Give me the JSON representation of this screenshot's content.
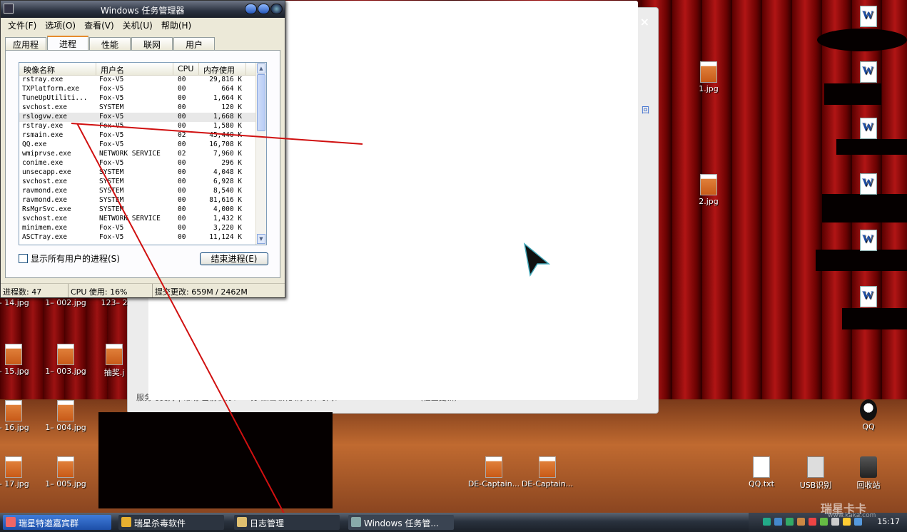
{
  "task_manager": {
    "title": "Windows 任务管理器",
    "menu": [
      "文件(F)",
      "选项(O)",
      "查看(V)",
      "关机(U)",
      "帮助(H)"
    ],
    "tabs": [
      "应用程序",
      "进程",
      "性能",
      "联网",
      "用户"
    ],
    "active_tab": "进程",
    "columns": [
      "映像名称",
      "用户名",
      "CPU",
      "内存使用"
    ],
    "rows": [
      [
        "rstray.exe",
        "Fox-V5",
        "00",
        "29,816 K"
      ],
      [
        "TXPlatform.exe",
        "Fox-V5",
        "00",
        "664 K"
      ],
      [
        "TuneUpUtiliti...",
        "Fox-V5",
        "00",
        "1,664 K"
      ],
      [
        "svchost.exe",
        "SYSTEM",
        "00",
        "120 K"
      ],
      [
        "rslogvw.exe",
        "Fox-V5",
        "00",
        "1,668 K"
      ],
      [
        "rstray.exe",
        "Fox-V5",
        "00",
        "1,580 K"
      ],
      [
        "rsmain.exe",
        "Fox-V5",
        "02",
        "45,440 K"
      ],
      [
        "QQ.exe",
        "Fox-V5",
        "00",
        "16,708 K"
      ],
      [
        "wmiprvse.exe",
        "NETWORK SERVICE",
        "02",
        "7,960 K"
      ],
      [
        "conime.exe",
        "Fox-V5",
        "00",
        "296 K"
      ],
      [
        "unsecapp.exe",
        "SYSTEM",
        "00",
        "4,048 K"
      ],
      [
        "svchost.exe",
        "SYSTEM",
        "00",
        "6,928 K"
      ],
      [
        "ravmond.exe",
        "SYSTEM",
        "00",
        "8,540 K"
      ],
      [
        "ravmond.exe",
        "SYSTEM",
        "00",
        "81,616 K"
      ],
      [
        "RsMgrSvc.exe",
        "SYSTEM",
        "00",
        "4,000 K"
      ],
      [
        "svchost.exe",
        "NETWORK SERVICE",
        "00",
        "1,432 K"
      ],
      [
        "minimem.exe",
        "Fox-V5",
        "00",
        "3,220 K"
      ],
      [
        "ASCTray.exe",
        "Fox-V5",
        "00",
        "11,124 K"
      ]
    ],
    "selected_row": 4,
    "show_all_users_label": "显示所有用户的进程(S)",
    "end_process_label": "结束进程(E)",
    "status": {
      "processes": "进程数: 47",
      "cpu": "CPU 使用: 16%",
      "commit": "提交更改: 659M / 2462M"
    }
  },
  "background_app": {
    "footer_text": "服务与支持 | 帮助          当前积分：30分 点击领礼        病毒库时间：2011-12-26 13:00  （检查更新）",
    "side_text": "回",
    "close_glyph": "×"
  },
  "desktop_icons_left": [
    {
      "label": "– 14.jpg",
      "type": "jpg"
    },
    {
      "label": "1– 002.jpg",
      "type": "jpg"
    },
    {
      "label": "123– 2",
      "type": "jpg"
    },
    {
      "label": "– 15.jpg",
      "type": "jpg"
    },
    {
      "label": "1– 003.jpg",
      "type": "jpg"
    },
    {
      "label": "抽奖.j",
      "type": "jpg"
    },
    {
      "label": "– 16.jpg",
      "type": "jpg"
    },
    {
      "label": "1– 004.jpg",
      "type": "jpg"
    },
    {
      "label": "– 17.jpg",
      "type": "jpg"
    },
    {
      "label": "1– 005.jpg",
      "type": "jpg"
    }
  ],
  "desktop_icons_right": [
    {
      "label": "1.jpg",
      "type": "jpg"
    },
    {
      "label": "2.jpg",
      "type": "jpg"
    },
    {
      "label": "DE-Captain...",
      "type": "jpg"
    },
    {
      "label": "DE-Captain...",
      "type": "jpg"
    },
    {
      "label": "QQ.txt",
      "type": "txt"
    },
    {
      "label": "USB识别",
      "type": "usb"
    },
    {
      "label": "回收站",
      "type": "trash"
    },
    {
      "label": "QQ",
      "type": "qq"
    }
  ],
  "taskbar": {
    "buttons": [
      "瑞星特邀嘉宾群",
      "瑞星杀毒软件",
      "日志管理",
      "Windows 任务管..."
    ],
    "clock": "15:17"
  },
  "watermark": {
    "text": "瑞星卡卡",
    "sub": "www.kaka.com"
  },
  "colors": {
    "annotation_line": "#d01010",
    "selection_gray": "#e8e8e8"
  }
}
